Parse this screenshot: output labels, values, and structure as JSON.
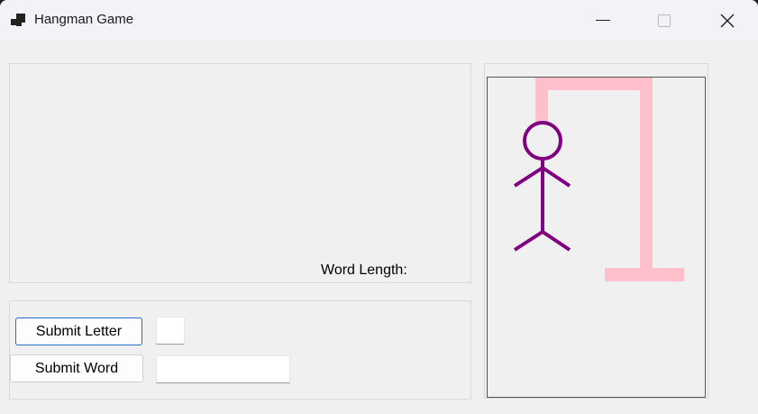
{
  "window": {
    "title": "Hangman Game",
    "icon": "app-icon"
  },
  "word_panel": {
    "word_length_label": "Word Length:"
  },
  "controls": {
    "submit_letter_label": "Submit Letter",
    "submit_word_label": "Submit Word",
    "letter_value": "",
    "word_value": ""
  },
  "drawing": {
    "gallows_color": "#ffc0cb",
    "figure_color": "#800080"
  }
}
